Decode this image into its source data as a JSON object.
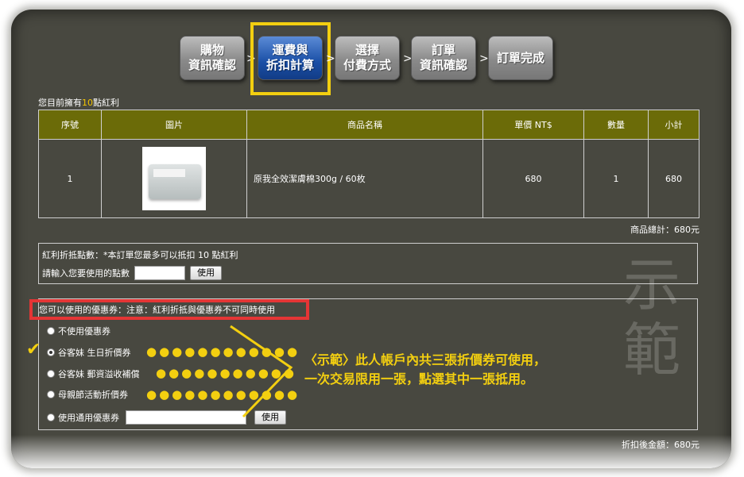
{
  "steps": [
    {
      "label": "購物\n資訊確認",
      "active": false
    },
    {
      "label": "運費與\n折扣計算",
      "active": true
    },
    {
      "label": "選擇\n付費方式",
      "active": false
    },
    {
      "label": "訂單\n資訊確認",
      "active": false
    },
    {
      "label": "訂單完成",
      "active": false
    }
  ],
  "step_separator": ">",
  "points_line": {
    "prefix": "您目前擁有",
    "count": "10",
    "suffix": "點紅利"
  },
  "table": {
    "headers": [
      "序號",
      "圖片",
      "商品名稱",
      "單價 NT$",
      "數量",
      "小計"
    ],
    "rows": [
      {
        "index": "1",
        "name": "原我全效潔膚棉300g / 60枚",
        "price": "680",
        "qty": "1",
        "subtotal": "680"
      }
    ]
  },
  "product_total": "商品總計：680元",
  "bonus": {
    "line1": "紅利折抵點數：*本訂單您最多可以抵扣 10 點紅利",
    "line2": "請輸入您要使用的點數",
    "button": "使用"
  },
  "coupons": {
    "header": "您可以使用的優惠券：注意：紅利折抵與優惠券不可同時使用",
    "options": [
      {
        "label": "不使用優惠券",
        "checked": false
      },
      {
        "label": "谷客妹 生日折價券",
        "checked": true
      },
      {
        "label": "谷客妹 郵資溢收補償",
        "checked": false
      },
      {
        "label": "母親節活動折價券",
        "checked": false
      },
      {
        "label": "使用通用優惠券",
        "checked": false
      }
    ],
    "button": "使用"
  },
  "annotation": "〈示範〉此人帳戶內共三張折價券可使用，\n一次交易限用一張，點選其中一張抵用。",
  "watermark": "示\n範",
  "after_discount_total": "折扣後金額：680元",
  "colors": {
    "frame_bg": "#484840",
    "header_olive": "#6b6b08",
    "highlight_yellow": "#f3cf10",
    "highlight_red": "#e53535",
    "active_step": "#1a4fa6"
  }
}
